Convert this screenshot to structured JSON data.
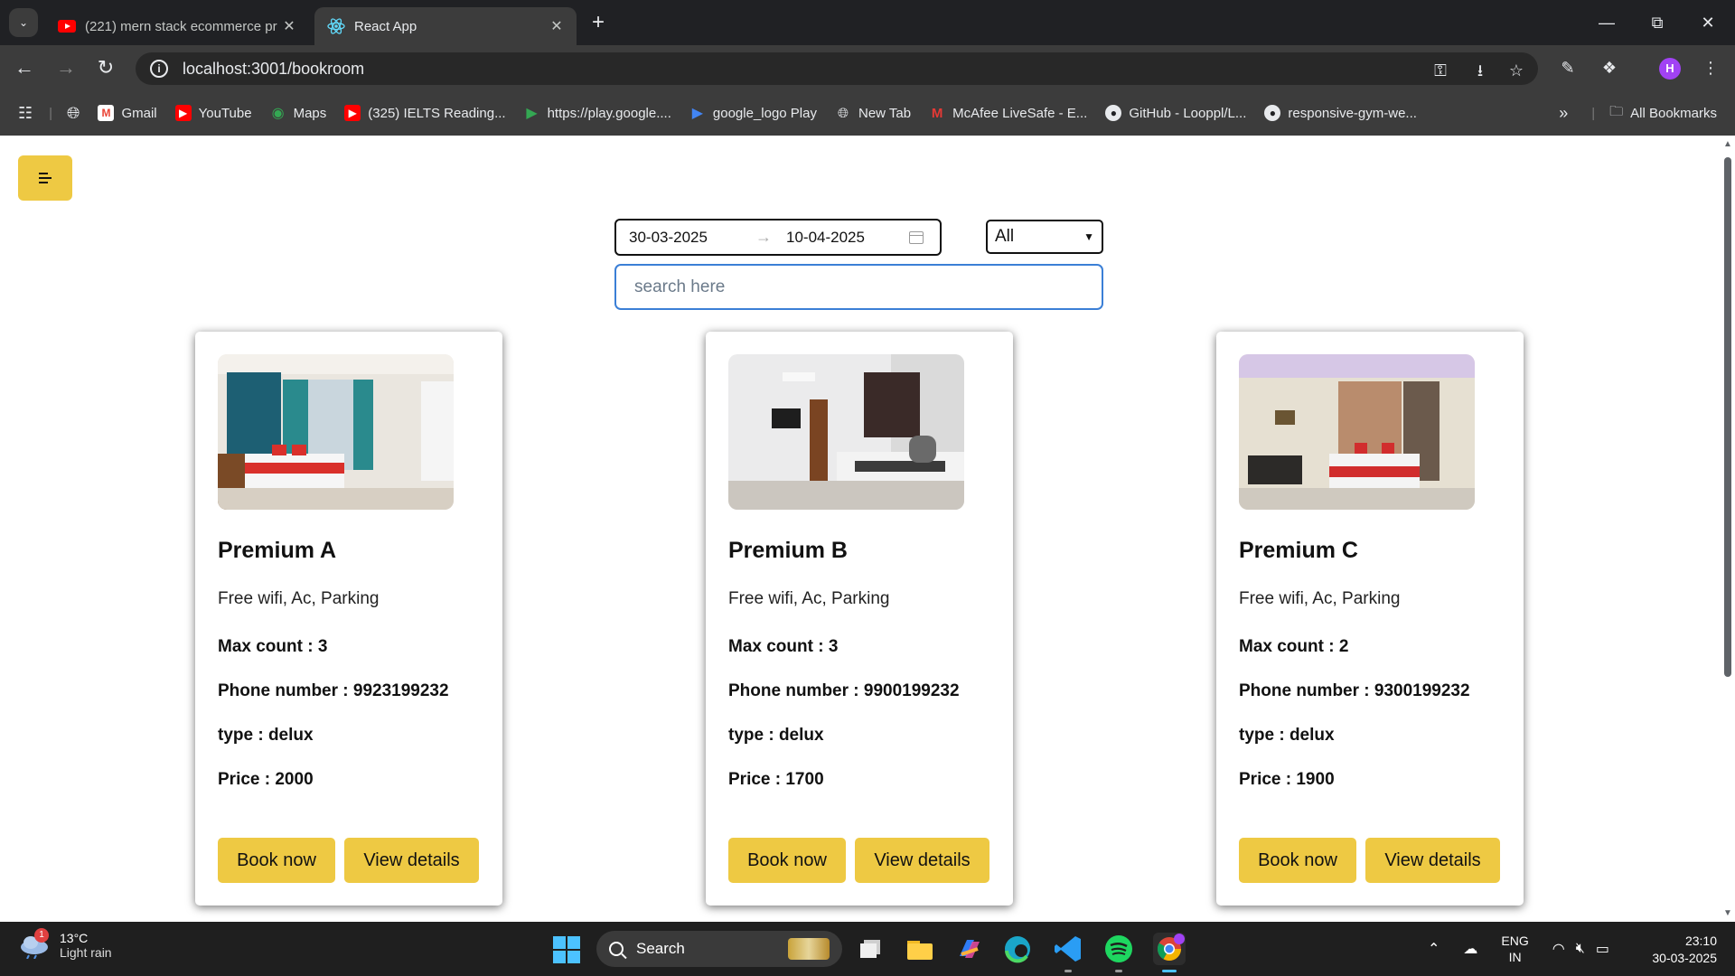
{
  "browser": {
    "tabs": [
      {
        "title": "(221) mern stack ecommerce pr",
        "active": false
      },
      {
        "title": "React App",
        "active": true
      }
    ],
    "url": "localhost:3001/bookroom",
    "profile_initial": "H",
    "bookmarks": [
      {
        "label": "Gmail",
        "icon": "gmail-icon"
      },
      {
        "label": "YouTube",
        "icon": "youtube-icon"
      },
      {
        "label": "Maps",
        "icon": "maps-icon"
      },
      {
        "label": "(325) IELTS Reading...",
        "icon": "youtube-icon"
      },
      {
        "label": "https://play.google....",
        "icon": "play-icon"
      },
      {
        "label": "google_logo Play",
        "icon": "play-icon"
      },
      {
        "label": "New Tab",
        "icon": "globe-icon"
      },
      {
        "label": "McAfee LiveSafe - E...",
        "icon": "mcafee-icon"
      },
      {
        "label": "GitHub - Looppl/L...",
        "icon": "github-icon"
      },
      {
        "label": "responsive-gym-we...",
        "icon": "github-icon"
      }
    ],
    "all_bookmarks_label": "All Bookmarks"
  },
  "filters": {
    "from_date": "30-03-2025",
    "to_date": "10-04-2025",
    "type_selected": "All",
    "search_placeholder": "search here"
  },
  "rooms": [
    {
      "name": "Premium A",
      "amenities": "Free wifi, Ac, Parking",
      "max_count": "Max count : 3",
      "phone": "Phone number : 9923199232",
      "type": "type : delux",
      "price": "Price : 2000"
    },
    {
      "name": "Premium B",
      "amenities": "Free wifi, Ac, Parking",
      "max_count": "Max count : 3",
      "phone": "Phone number : 9900199232",
      "type": "type : delux",
      "price": "Price : 1700"
    },
    {
      "name": "Premium C",
      "amenities": "Free wifi, Ac, Parking",
      "max_count": "Max count : 2",
      "phone": "Phone number : 9300199232",
      "type": "type : delux",
      "price": "Price : 1900"
    }
  ],
  "buttons": {
    "book_now": "Book now",
    "view_details": "View details"
  },
  "colors": {
    "accent_yellow": "#eec943",
    "search_border": "#3b7fd6"
  },
  "taskbar": {
    "weather_temp": "13°C",
    "weather_desc": "Light rain",
    "weather_badge": "1",
    "search_label": "Search",
    "lang_line1": "ENG",
    "lang_line2": "IN",
    "time": "23:10",
    "date": "30-03-2025"
  }
}
